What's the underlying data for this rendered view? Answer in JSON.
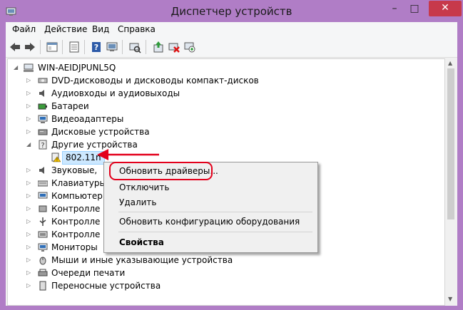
{
  "window": {
    "title": "Диспетчер устройств"
  },
  "menu": [
    "Файл",
    "Действие",
    "Вид",
    "Справка"
  ],
  "toolbar": {
    "buttons": [
      "back-icon",
      "forward-icon",
      "console-tree-icon",
      "properties-icon",
      "help-icon",
      "display-icon",
      "update-driver-icon",
      "uninstall-icon",
      "scan-hardware-icon"
    ]
  },
  "tree": {
    "root": "WIN-AEIDJPUNL5Q",
    "items": [
      {
        "label": "DVD-дисководы и дисководы компакт-дисков"
      },
      {
        "label": "Аудиовходы и аудиовыходы"
      },
      {
        "label": "Батареи"
      },
      {
        "label": "Видеоадаптеры"
      },
      {
        "label": "Дисковые устройства"
      },
      {
        "label": "Другие устройства"
      },
      {
        "label": "802.11n"
      },
      {
        "label": "Звуковые,"
      },
      {
        "label": "Клавиатуры"
      },
      {
        "label": "Компьютер"
      },
      {
        "label": "Контролле"
      },
      {
        "label": "Контролле"
      },
      {
        "label": "Контролле"
      },
      {
        "label": "Мониторы"
      },
      {
        "label": "Мыши и иные указывающие устройства"
      },
      {
        "label": "Очереди печати"
      },
      {
        "label": "Переносные устройства"
      }
    ]
  },
  "context_menu": {
    "update_driver": "Обновить драйверы...",
    "disable": "Отключить",
    "uninstall": "Удалить",
    "scan": "Обновить конфигурацию оборудования",
    "properties": "Свойства"
  },
  "colors": {
    "frame": "#b07dc6",
    "close": "#c7394b",
    "highlight": "#e3001b",
    "selection": "#cce8ff"
  }
}
